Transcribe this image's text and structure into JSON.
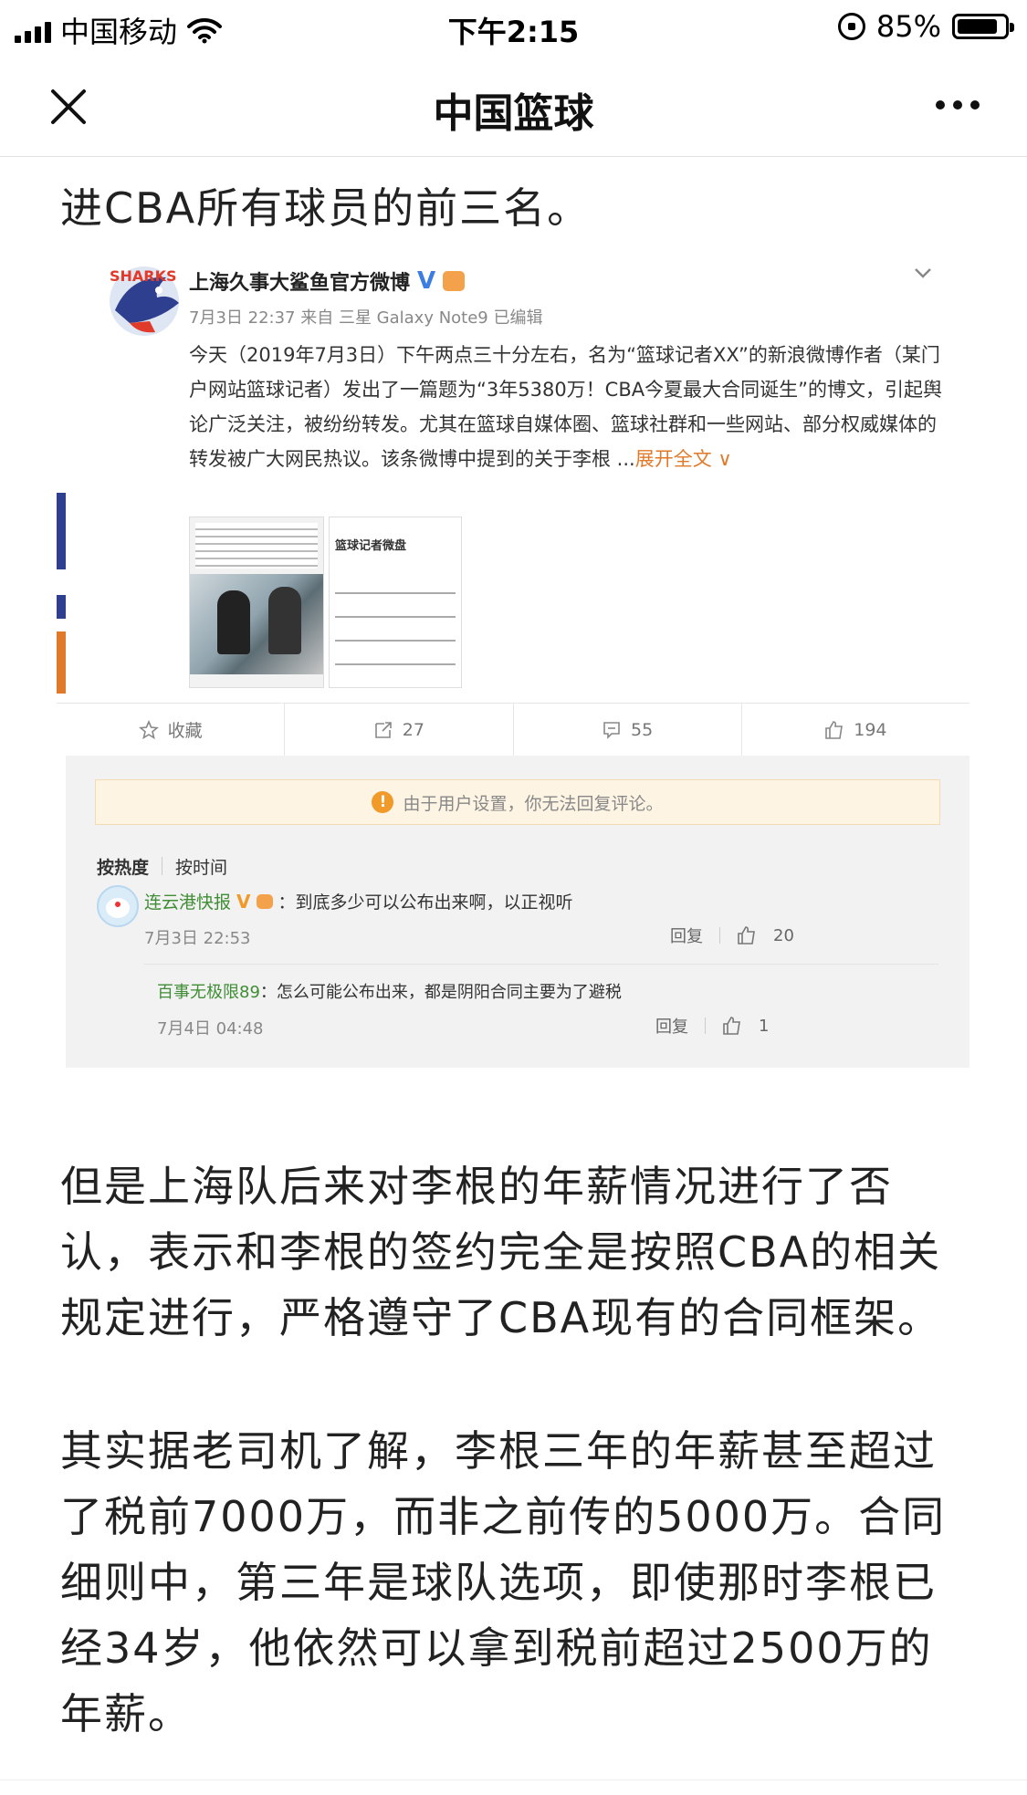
{
  "status_bar": {
    "carrier": "中国移动",
    "time": "下午2:15",
    "battery": "85%",
    "battery_level": 0.85,
    "icons": [
      "signal-icon",
      "wifi-icon",
      "rotation-lock-icon",
      "battery-icon"
    ]
  },
  "nav": {
    "title": "中国篮球",
    "close_icon": "close-icon",
    "more_icon": "more-icon"
  },
  "article": {
    "para1": "进CBA所有球员的前三名。",
    "para2": "但是上海队后来对李根的年薪情况进行了否认，表示和李根的签约完全是按照CBA的相关规定进行，严格遵守了CBA现有的合同框架。",
    "para3": "其实据老司机了解，李根三年的年薪甚至超过了税前7000万，而非之前传的5000万。合同细则中，第三年是球队选项，即使那时李根已经34岁，他依然可以拿到税前超过2500万的年薪。"
  },
  "embed": {
    "avatar_logo": "SHARKS",
    "user": "上海久事大鲨鱼官方微博",
    "verified": "V",
    "meta": "7月3日 22:37 来自 三星 Galaxy Note9  已编辑",
    "body": "今天（2019年7月3日）下午两点三十分左右，名为“篮球记者XX”的新浪微博作者（某门户网站篮球记者）发出了一篇题为“3年5380万！CBA今夏最大合同诞生”的博文，引起舆论广泛关注，被纷纷转发。尤其在篮球自媒体圈、篮球社群和一些网站、部分权威媒体的转发被广大网民热议。该条微博中提到的关于李根 ...",
    "expand": "展开全文",
    "thumb2_title": "篮球记者微盘",
    "actions": {
      "favorite": "收藏",
      "repost": "27",
      "comment": "55",
      "like": "194"
    },
    "notice": "由于用户设置，你无法回复评论。",
    "sort": {
      "hot": "按热度",
      "time": "按时间"
    },
    "comment": {
      "user": "连云港快报",
      "text": "：到底多少可以公布出来啊，以正视听",
      "time": "7月3日 22:53",
      "reply_label": "回复",
      "likes": "20"
    },
    "sub_reply": {
      "user": "百事无极限89",
      "text": "：怎么可能公布出来，都是阴阳合同主要为了避税",
      "time": "7月4日 04:48",
      "reply_label": "回复",
      "likes": "1"
    }
  }
}
